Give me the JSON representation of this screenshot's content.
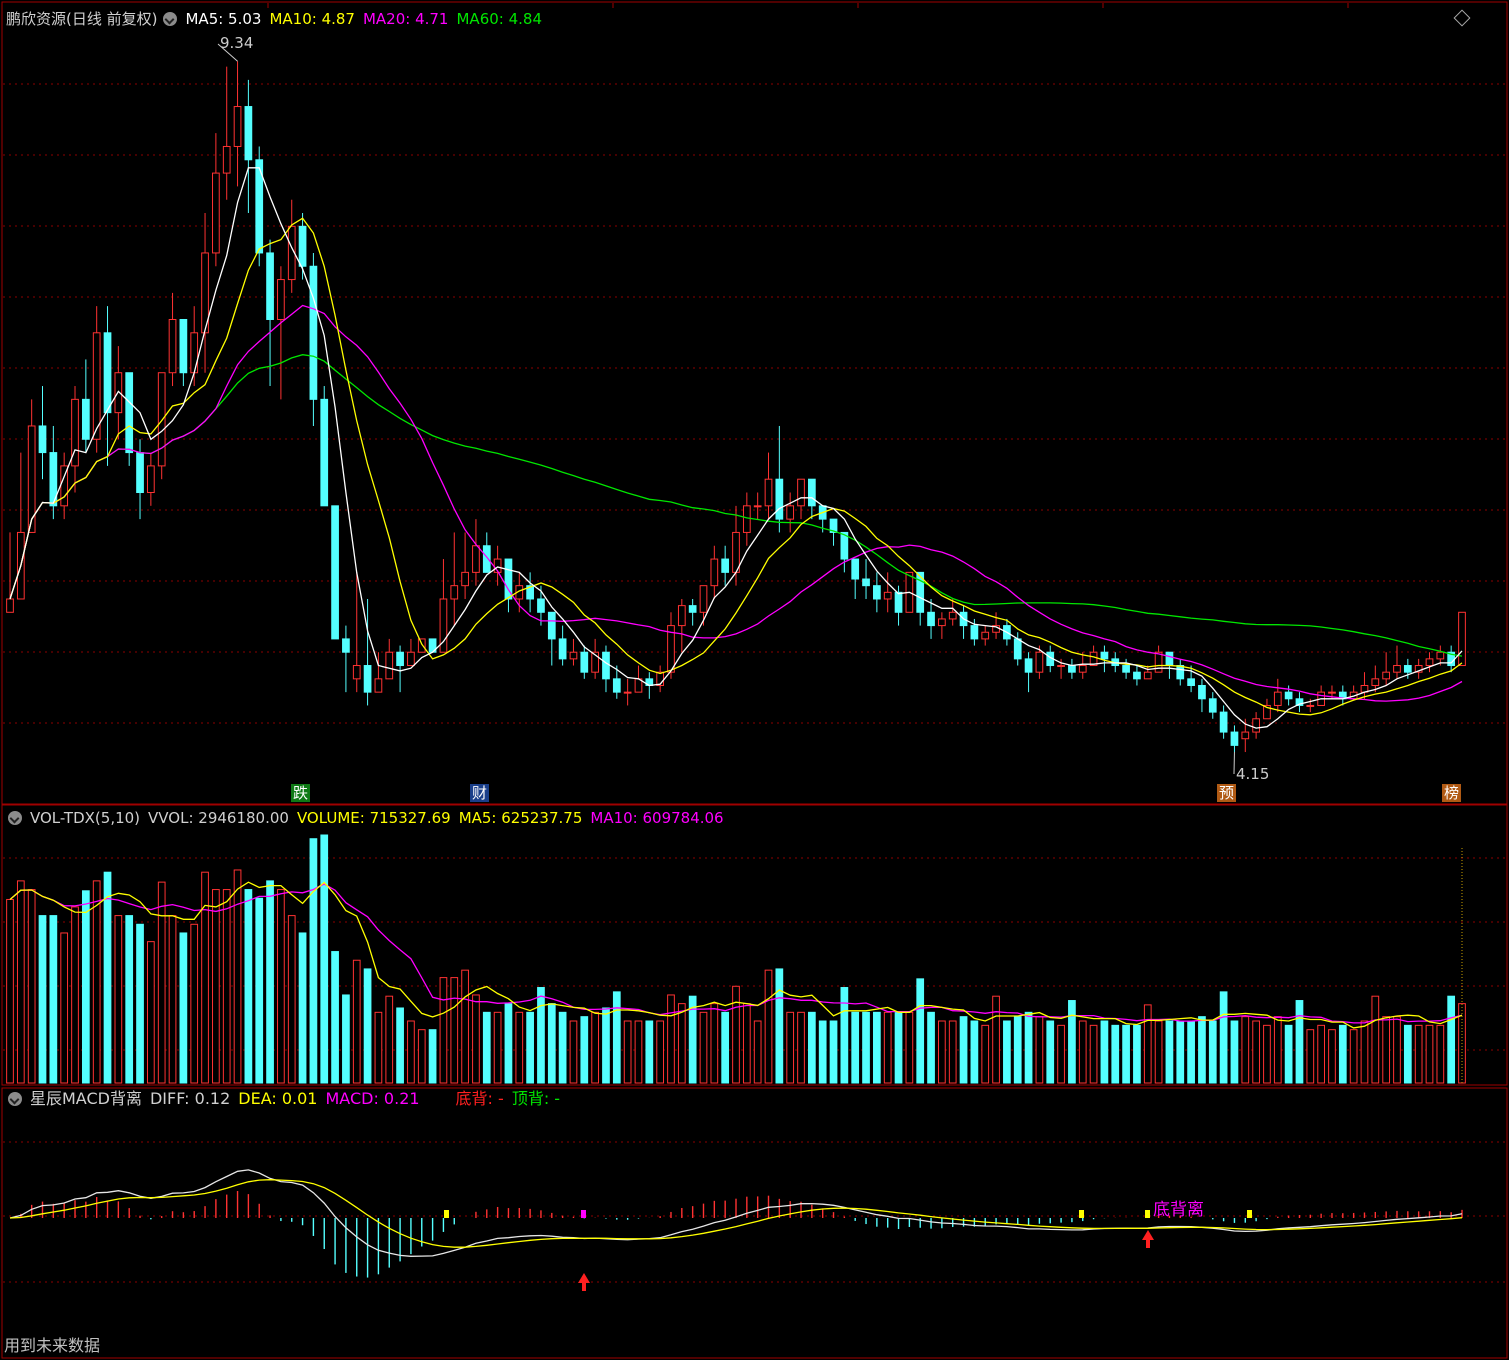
{
  "stock": {
    "title": "鹏欣资源(日线 前复权)",
    "ma5_label": "MA5: 5.03",
    "ma10_label": "MA10: 4.87",
    "ma20_label": "MA20: 4.71",
    "ma60_label": "MA60: 4.84"
  },
  "volume_panel": {
    "name": "VOL-TDX(5,10)",
    "vvol": "VVOL: 2946180.00",
    "volume": "VOLUME: 715327.69",
    "ma5": "MA5: 625237.75",
    "ma10": "MA10: 609784.06"
  },
  "macd_panel": {
    "name": "星辰MACD背离",
    "diff": "DIFF: 0.12",
    "dea": "DEA: 0.01",
    "macd": "MACD: 0.21",
    "bottom_div": "底背: -",
    "top_div": "顶背: -",
    "divergence_label": "底背离"
  },
  "annotations": {
    "high": "9.34",
    "low": "4.15",
    "tags": [
      "跌",
      "财",
      "预",
      "榜"
    ]
  },
  "footer": "用到未来数据",
  "colors": {
    "up": "#ff3232",
    "down": "#54ffff",
    "ma5": "#ffffff",
    "ma10": "#ffff00",
    "ma20": "#ff00ff",
    "ma60": "#00e600",
    "grid": "#8b0000"
  },
  "chart_data": [
    {
      "type": "candlestick",
      "title": "鹏欣资源(日线 前复权)",
      "high_marker": 9.34,
      "low_marker": 4.15,
      "ylim": [
        4.0,
        9.5
      ],
      "candles": [
        [
          5.2,
          5.3,
          5.2,
          5.8
        ],
        [
          5.3,
          5.8,
          5.3,
          6.4
        ],
        [
          5.8,
          6.6,
          5.8,
          6.8
        ],
        [
          6.6,
          6.4,
          6.2,
          6.9
        ],
        [
          6.4,
          6.0,
          5.9,
          6.6
        ],
        [
          6.0,
          6.3,
          5.9,
          6.4
        ],
        [
          6.3,
          6.8,
          6.1,
          6.9
        ],
        [
          6.8,
          6.5,
          6.4,
          7.1
        ],
        [
          6.5,
          7.3,
          6.4,
          7.5
        ],
        [
          7.3,
          6.7,
          6.3,
          7.5
        ],
        [
          6.7,
          7.0,
          6.5,
          7.2
        ],
        [
          7.0,
          6.4,
          6.3,
          7.0
        ],
        [
          6.4,
          6.1,
          5.9,
          6.5
        ],
        [
          6.1,
          6.3,
          6.0,
          6.4
        ],
        [
          6.3,
          7.0,
          6.2,
          7.0
        ],
        [
          7.0,
          7.4,
          6.9,
          7.6
        ],
        [
          7.4,
          7.0,
          6.9,
          7.4
        ],
        [
          7.0,
          7.3,
          6.9,
          7.5
        ],
        [
          7.3,
          7.9,
          7.0,
          8.2
        ],
        [
          7.9,
          8.5,
          7.8,
          8.8
        ],
        [
          8.5,
          8.7,
          8.3,
          9.3
        ],
        [
          8.7,
          9.0,
          8.4,
          9.34
        ],
        [
          9.0,
          8.6,
          8.2,
          9.2
        ],
        [
          8.6,
          7.9,
          7.8,
          8.7
        ],
        [
          7.9,
          7.4,
          6.9,
          8.0
        ],
        [
          7.4,
          7.7,
          6.8,
          7.8
        ],
        [
          7.7,
          8.1,
          7.6,
          8.3
        ],
        [
          8.1,
          7.8,
          7.7,
          8.2
        ],
        [
          7.8,
          6.8,
          6.6,
          7.9
        ],
        [
          6.8,
          6.0,
          6.0,
          6.9
        ],
        [
          6.0,
          5.0,
          5.0,
          6.0
        ],
        [
          5.0,
          4.9,
          4.6,
          5.1
        ],
        [
          4.7,
          4.8,
          4.6,
          5.5
        ],
        [
          4.8,
          4.6,
          4.5,
          5.3
        ],
        [
          4.6,
          4.7,
          4.6,
          4.9
        ],
        [
          4.7,
          4.9,
          4.8,
          5.0
        ],
        [
          4.9,
          4.8,
          4.6,
          4.95
        ],
        [
          4.8,
          4.9,
          4.8,
          5.0
        ],
        [
          4.9,
          5.0,
          4.9,
          5.0
        ],
        [
          5.0,
          4.9,
          4.9,
          5.0
        ],
        [
          4.9,
          5.3,
          4.9,
          5.6
        ],
        [
          5.3,
          5.4,
          5.1,
          5.8
        ],
        [
          5.4,
          5.5,
          5.3,
          5.8
        ],
        [
          5.5,
          5.7,
          5.4,
          5.9
        ],
        [
          5.7,
          5.5,
          5.5,
          5.8
        ],
        [
          5.5,
          5.6,
          5.4,
          5.7
        ],
        [
          5.6,
          5.3,
          5.2,
          5.6
        ],
        [
          5.3,
          5.4,
          5.2,
          5.5
        ],
        [
          5.4,
          5.3,
          5.2,
          5.5
        ],
        [
          5.3,
          5.2,
          5.1,
          5.4
        ],
        [
          5.2,
          5.0,
          4.8,
          5.2
        ],
        [
          5.0,
          4.85,
          4.8,
          5.1
        ],
        [
          4.85,
          4.9,
          4.8,
          5.0
        ],
        [
          4.9,
          4.75,
          4.7,
          4.95
        ],
        [
          4.75,
          4.9,
          4.7,
          5.0
        ],
        [
          4.9,
          4.7,
          4.6,
          4.95
        ],
        [
          4.7,
          4.6,
          4.55,
          4.8
        ],
        [
          4.6,
          4.6,
          4.5,
          4.7
        ],
        [
          4.6,
          4.7,
          4.6,
          4.8
        ],
        [
          4.7,
          4.65,
          4.55,
          4.75
        ],
        [
          4.65,
          4.75,
          4.6,
          4.8
        ],
        [
          4.75,
          5.1,
          4.7,
          5.2
        ],
        [
          5.1,
          5.25,
          4.9,
          5.3
        ],
        [
          5.25,
          5.2,
          5.1,
          5.3
        ],
        [
          5.2,
          5.4,
          5.1,
          5.4
        ],
        [
          5.4,
          5.6,
          5.3,
          5.7
        ],
        [
          5.6,
          5.5,
          5.4,
          5.7
        ],
        [
          5.5,
          5.8,
          5.4,
          6.0
        ],
        [
          5.8,
          6.0,
          5.7,
          6.1
        ],
        [
          6.0,
          6.0,
          5.9,
          6.1
        ],
        [
          6.0,
          6.2,
          5.9,
          6.4
        ],
        [
          6.2,
          5.9,
          5.8,
          6.6
        ],
        [
          5.9,
          6.0,
          5.8,
          6.1
        ],
        [
          6.0,
          6.2,
          5.9,
          6.2
        ],
        [
          6.2,
          6.0,
          5.9,
          6.2
        ],
        [
          6.0,
          5.9,
          5.8,
          6.0
        ],
        [
          5.9,
          5.8,
          5.7,
          5.9
        ],
        [
          5.8,
          5.6,
          5.5,
          5.8
        ],
        [
          5.6,
          5.45,
          5.3,
          5.6
        ],
        [
          5.45,
          5.4,
          5.3,
          5.6
        ],
        [
          5.4,
          5.3,
          5.2,
          5.5
        ],
        [
          5.3,
          5.35,
          5.2,
          5.5
        ],
        [
          5.35,
          5.2,
          5.1,
          5.4
        ],
        [
          5.2,
          5.5,
          5.2,
          5.5
        ],
        [
          5.5,
          5.2,
          5.1,
          5.5
        ],
        [
          5.2,
          5.1,
          5.0,
          5.3
        ],
        [
          5.1,
          5.15,
          5.0,
          5.2
        ],
        [
          5.15,
          5.2,
          5.1,
          5.3
        ],
        [
          5.2,
          5.1,
          5.0,
          5.25
        ],
        [
          5.1,
          5.0,
          4.95,
          5.15
        ],
        [
          5.0,
          5.05,
          4.95,
          5.1
        ],
        [
          5.05,
          5.1,
          5.0,
          5.2
        ],
        [
          5.1,
          5.0,
          4.95,
          5.15
        ],
        [
          5.0,
          4.85,
          4.8,
          5.05
        ],
        [
          4.85,
          4.75,
          4.6,
          4.9
        ],
        [
          4.75,
          4.9,
          4.7,
          4.95
        ],
        [
          4.9,
          4.8,
          4.75,
          4.95
        ],
        [
          4.8,
          4.8,
          4.7,
          4.85
        ],
        [
          4.8,
          4.75,
          4.7,
          4.85
        ],
        [
          4.75,
          4.8,
          4.7,
          4.9
        ],
        [
          4.8,
          4.9,
          4.8,
          4.95
        ],
        [
          4.9,
          4.85,
          4.75,
          4.95
        ],
        [
          4.85,
          4.8,
          4.75,
          4.9
        ],
        [
          4.8,
          4.75,
          4.7,
          4.85
        ],
        [
          4.75,
          4.7,
          4.65,
          4.8
        ],
        [
          4.7,
          4.75,
          4.7,
          4.8
        ],
        [
          4.75,
          4.9,
          4.75,
          4.95
        ],
        [
          4.9,
          4.8,
          4.7,
          4.9
        ],
        [
          4.8,
          4.7,
          4.65,
          4.85
        ],
        [
          4.7,
          4.65,
          4.6,
          4.8
        ],
        [
          4.65,
          4.55,
          4.45,
          4.7
        ],
        [
          4.55,
          4.45,
          4.4,
          4.6
        ],
        [
          4.45,
          4.3,
          4.25,
          4.5
        ],
        [
          4.3,
          4.2,
          4.15,
          4.35
        ],
        [
          4.25,
          4.3,
          4.15,
          4.4
        ],
        [
          4.3,
          4.4,
          4.25,
          4.45
        ],
        [
          4.4,
          4.5,
          4.4,
          4.55
        ],
        [
          4.5,
          4.6,
          4.45,
          4.7
        ],
        [
          4.6,
          4.55,
          4.5,
          4.65
        ],
        [
          4.55,
          4.5,
          4.45,
          4.6
        ],
        [
          4.5,
          4.5,
          4.45,
          4.55
        ],
        [
          4.5,
          4.6,
          4.5,
          4.65
        ],
        [
          4.6,
          4.6,
          4.55,
          4.65
        ],
        [
          4.6,
          4.55,
          4.5,
          4.65
        ],
        [
          4.55,
          4.6,
          4.55,
          4.65
        ],
        [
          4.6,
          4.65,
          4.55,
          4.75
        ],
        [
          4.65,
          4.7,
          4.6,
          4.8
        ],
        [
          4.7,
          4.75,
          4.65,
          4.9
        ],
        [
          4.75,
          4.8,
          4.7,
          4.95
        ],
        [
          4.8,
          4.75,
          4.7,
          4.85
        ],
        [
          4.75,
          4.8,
          4.7,
          4.85
        ],
        [
          4.8,
          4.85,
          4.75,
          4.9
        ],
        [
          4.85,
          4.9,
          4.8,
          4.95
        ],
        [
          4.9,
          4.8,
          4.75,
          4.95
        ],
        [
          4.8,
          5.2,
          4.8,
          5.2
        ]
      ]
    },
    {
      "type": "bar",
      "title": "VOL-TDX(5,10)",
      "description_values": {
        "vvol": 2946180.0,
        "volume": 715327.69,
        "ma5": 625237.75,
        "ma10": 609784.06
      }
    },
    {
      "type": "line",
      "title": "星辰MACD背离",
      "diff": 0.12,
      "dea": 0.01,
      "macd": 0.21
    }
  ]
}
